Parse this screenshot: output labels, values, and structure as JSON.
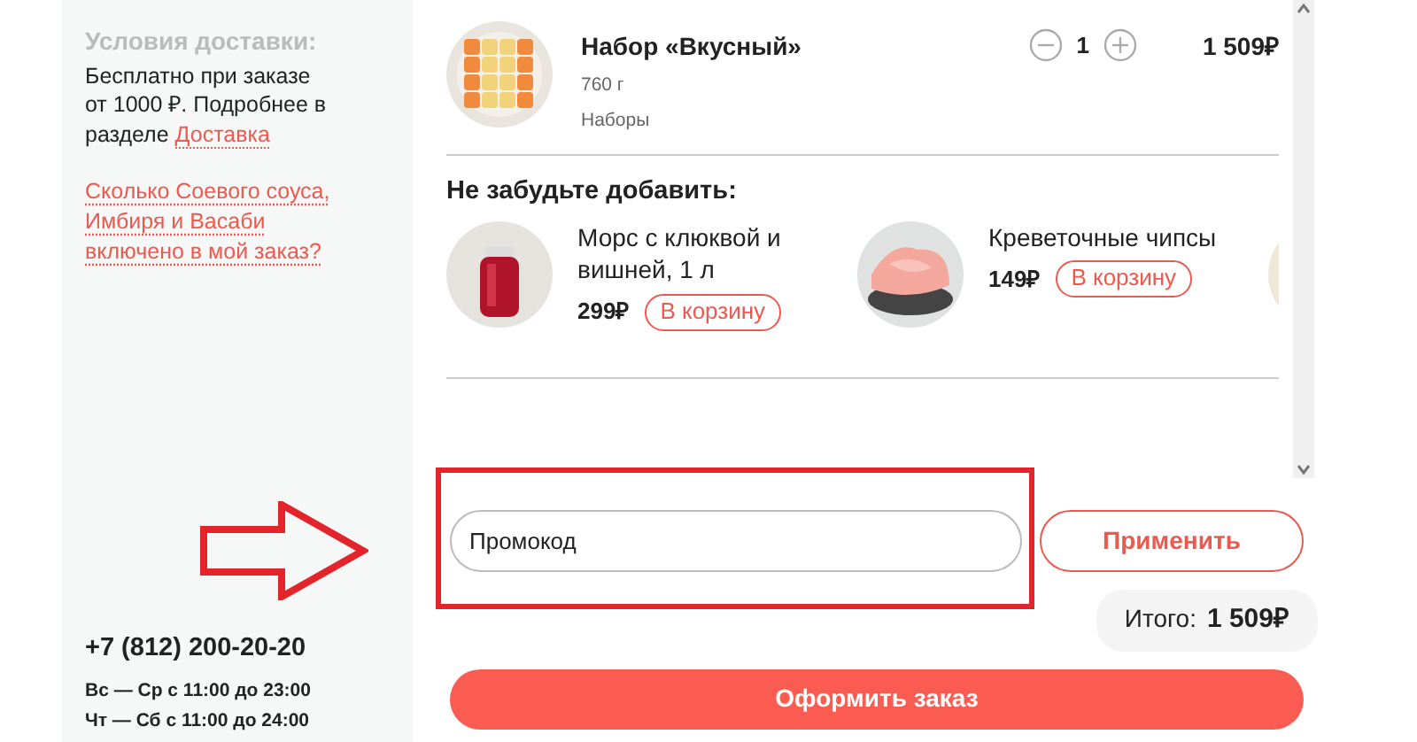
{
  "sidebar": {
    "delivery_title": "Условия доставки:",
    "delivery_text": "Бесплатно при заказе от 1000 ₽. Подробнее в разделе",
    "delivery_link": "Доставка",
    "sauce_link": "Сколько Соевого соуса, Имбиря и Васаби включено в мой заказ?",
    "phone": "+7 (812) 200-20-20",
    "hours": [
      "Вс — Ср с 11:00 до 23:00",
      "Чт — Сб с 11:00 до 24:00"
    ]
  },
  "cart_items": [
    {
      "name": "Набор «Вкусный»",
      "weight": "760 г",
      "category": "Наборы",
      "quantity": "1",
      "price": "1 509₽"
    }
  ],
  "recommendations": {
    "title": "Не забудьте добавить:",
    "items": [
      {
        "name": "Морс с клюквой и вишней, 1 л",
        "price": "299₽",
        "button": "В корзину"
      },
      {
        "name": "Креветочные чипсы",
        "price": "149₽",
        "button": "В корзину"
      }
    ]
  },
  "promo": {
    "placeholder": "Промокод",
    "button": "Применить"
  },
  "total": {
    "label": "Итого:",
    "value": "1 509₽"
  },
  "checkout_button": "Оформить заказ"
}
